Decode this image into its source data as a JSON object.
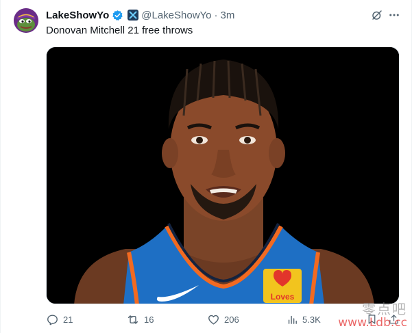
{
  "tweet": {
    "display_name": "LakeShowYo",
    "handle": "@LakeShowYo",
    "separator": "·",
    "time": "3m",
    "text": "Donovan Mitchell 21 free throws"
  },
  "actions": {
    "replies": "21",
    "reposts": "16",
    "likes": "206",
    "views": "5.3K"
  },
  "jersey_logo": "Loves",
  "watermark": {
    "chinese": "零点吧",
    "url": "www.Ldb.cc"
  },
  "colors": {
    "verified": "#1d9bf0",
    "jersey_blue": "#1e6fc4",
    "jersey_orange": "#f26a21",
    "text_primary": "#0f1419",
    "text_secondary": "#536471"
  },
  "icons": [
    "avatar-pepe",
    "verified-badge-icon",
    "affiliate-x-icon",
    "grok-icon",
    "more-icon",
    "reply-icon",
    "repost-icon",
    "like-icon",
    "views-icon",
    "bookmark-icon",
    "share-icon"
  ]
}
